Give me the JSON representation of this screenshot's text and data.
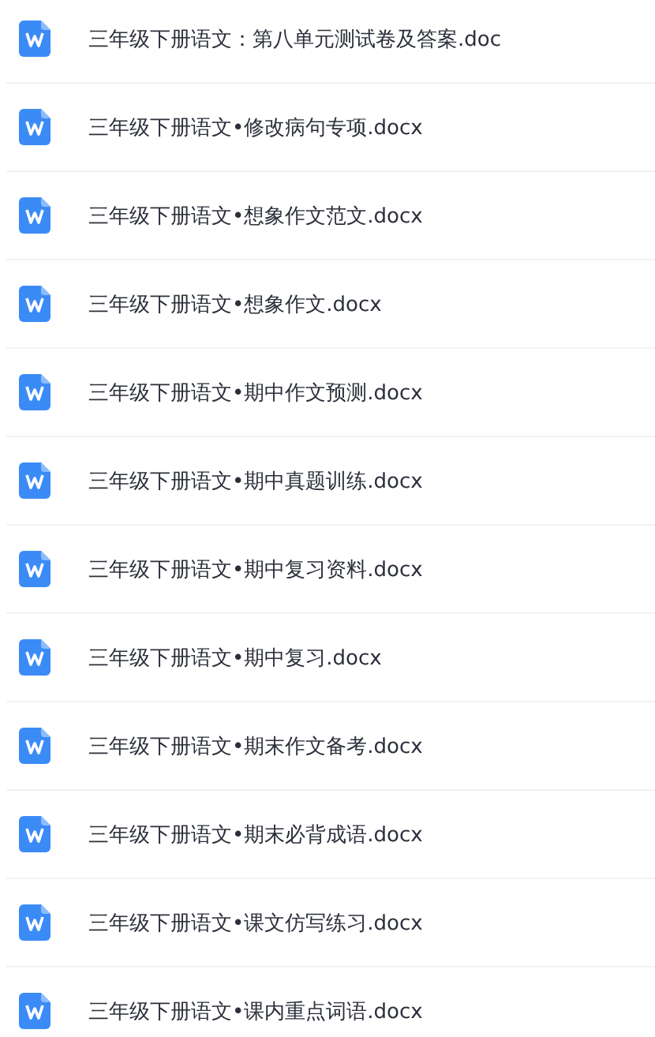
{
  "files": [
    {
      "name": "三年级下册语文：第八单元测试卷及答案.doc"
    },
    {
      "name": "三年级下册语文•修改病句专项.docx"
    },
    {
      "name": "三年级下册语文•想象作文范文.docx"
    },
    {
      "name": "三年级下册语文•想象作文.docx"
    },
    {
      "name": "三年级下册语文•期中作文预测.docx"
    },
    {
      "name": "三年级下册语文•期中真题训练.docx"
    },
    {
      "name": "三年级下册语文•期中复习资料.docx"
    },
    {
      "name": "三年级下册语文•期中复习.docx"
    },
    {
      "name": "三年级下册语文•期末作文备考.docx"
    },
    {
      "name": "三年级下册语文•期末必背成语.docx"
    },
    {
      "name": "三年级下册语文•课文仿写练习.docx"
    },
    {
      "name": "三年级下册语文•课内重点词语.docx"
    }
  ]
}
